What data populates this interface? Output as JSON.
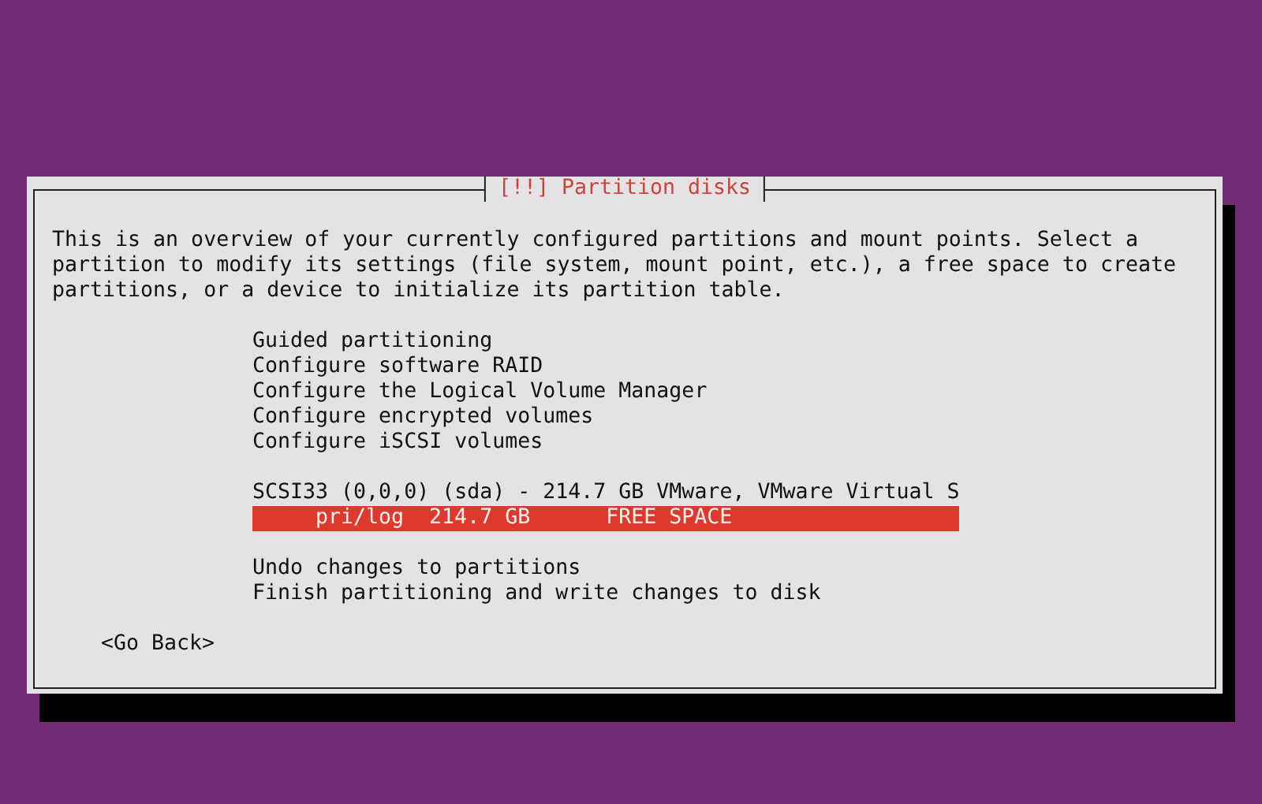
{
  "dialog": {
    "title": "[!!] Partition disks",
    "description": "This is an overview of your currently configured partitions and mount points. Select a\npartition to modify its settings (file system, mount point, etc.), a free space to create\npartitions, or a device to initialize its partition table.",
    "menu": [
      {
        "items": [
          {
            "kind": "action",
            "label": "Guided partitioning",
            "selected": false
          },
          {
            "kind": "action",
            "label": "Configure software RAID",
            "selected": false
          },
          {
            "kind": "action",
            "label": "Configure the Logical Volume Manager",
            "selected": false
          },
          {
            "kind": "action",
            "label": "Configure encrypted volumes",
            "selected": false
          },
          {
            "kind": "action",
            "label": "Configure iSCSI volumes",
            "selected": false
          }
        ]
      },
      {
        "items": [
          {
            "kind": "disk",
            "label": "SCSI33 (0,0,0) (sda) - 214.7 GB VMware, VMware Virtual S",
            "selected": false
          },
          {
            "kind": "partition",
            "label": "pri/log  214.7 GB      FREE SPACE",
            "selected": true
          }
        ]
      },
      {
        "items": [
          {
            "kind": "action",
            "label": "Undo changes to partitions",
            "selected": false
          },
          {
            "kind": "action",
            "label": "Finish partitioning and write changes to disk",
            "selected": false
          }
        ]
      }
    ],
    "buttons": [
      "<Go Back>"
    ]
  }
}
